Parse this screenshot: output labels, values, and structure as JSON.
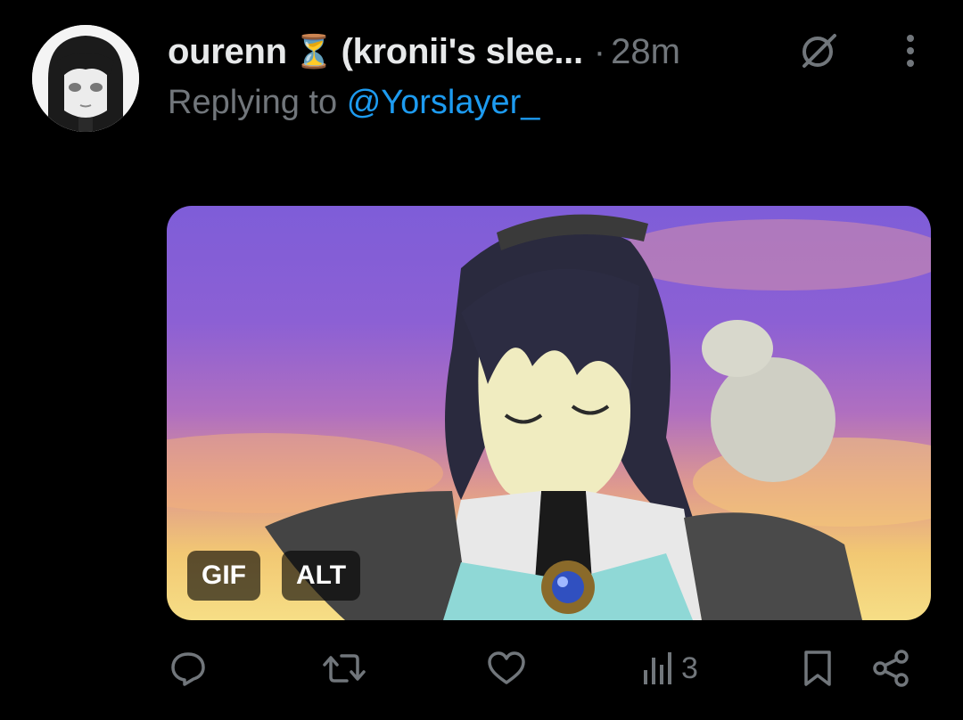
{
  "author": {
    "display_name": "ourenn",
    "status_emoji": "⏳",
    "name_suffix": "(kronii's slee...",
    "separator": "·",
    "timestamp": "28m"
  },
  "reply": {
    "prefix": "Replying to",
    "handle": "@Yorslayer_"
  },
  "media": {
    "gif_badge": "GIF",
    "alt_badge": "ALT"
  },
  "actions": {
    "views_count": "3"
  },
  "colors": {
    "background": "#000000",
    "text_primary": "#e7e9ea",
    "text_secondary": "#71767b",
    "link": "#1d9bf0"
  },
  "icons": [
    "grok-icon",
    "more-icon",
    "reply-icon",
    "repost-icon",
    "like-icon",
    "views-icon",
    "bookmark-icon",
    "share-icon"
  ]
}
